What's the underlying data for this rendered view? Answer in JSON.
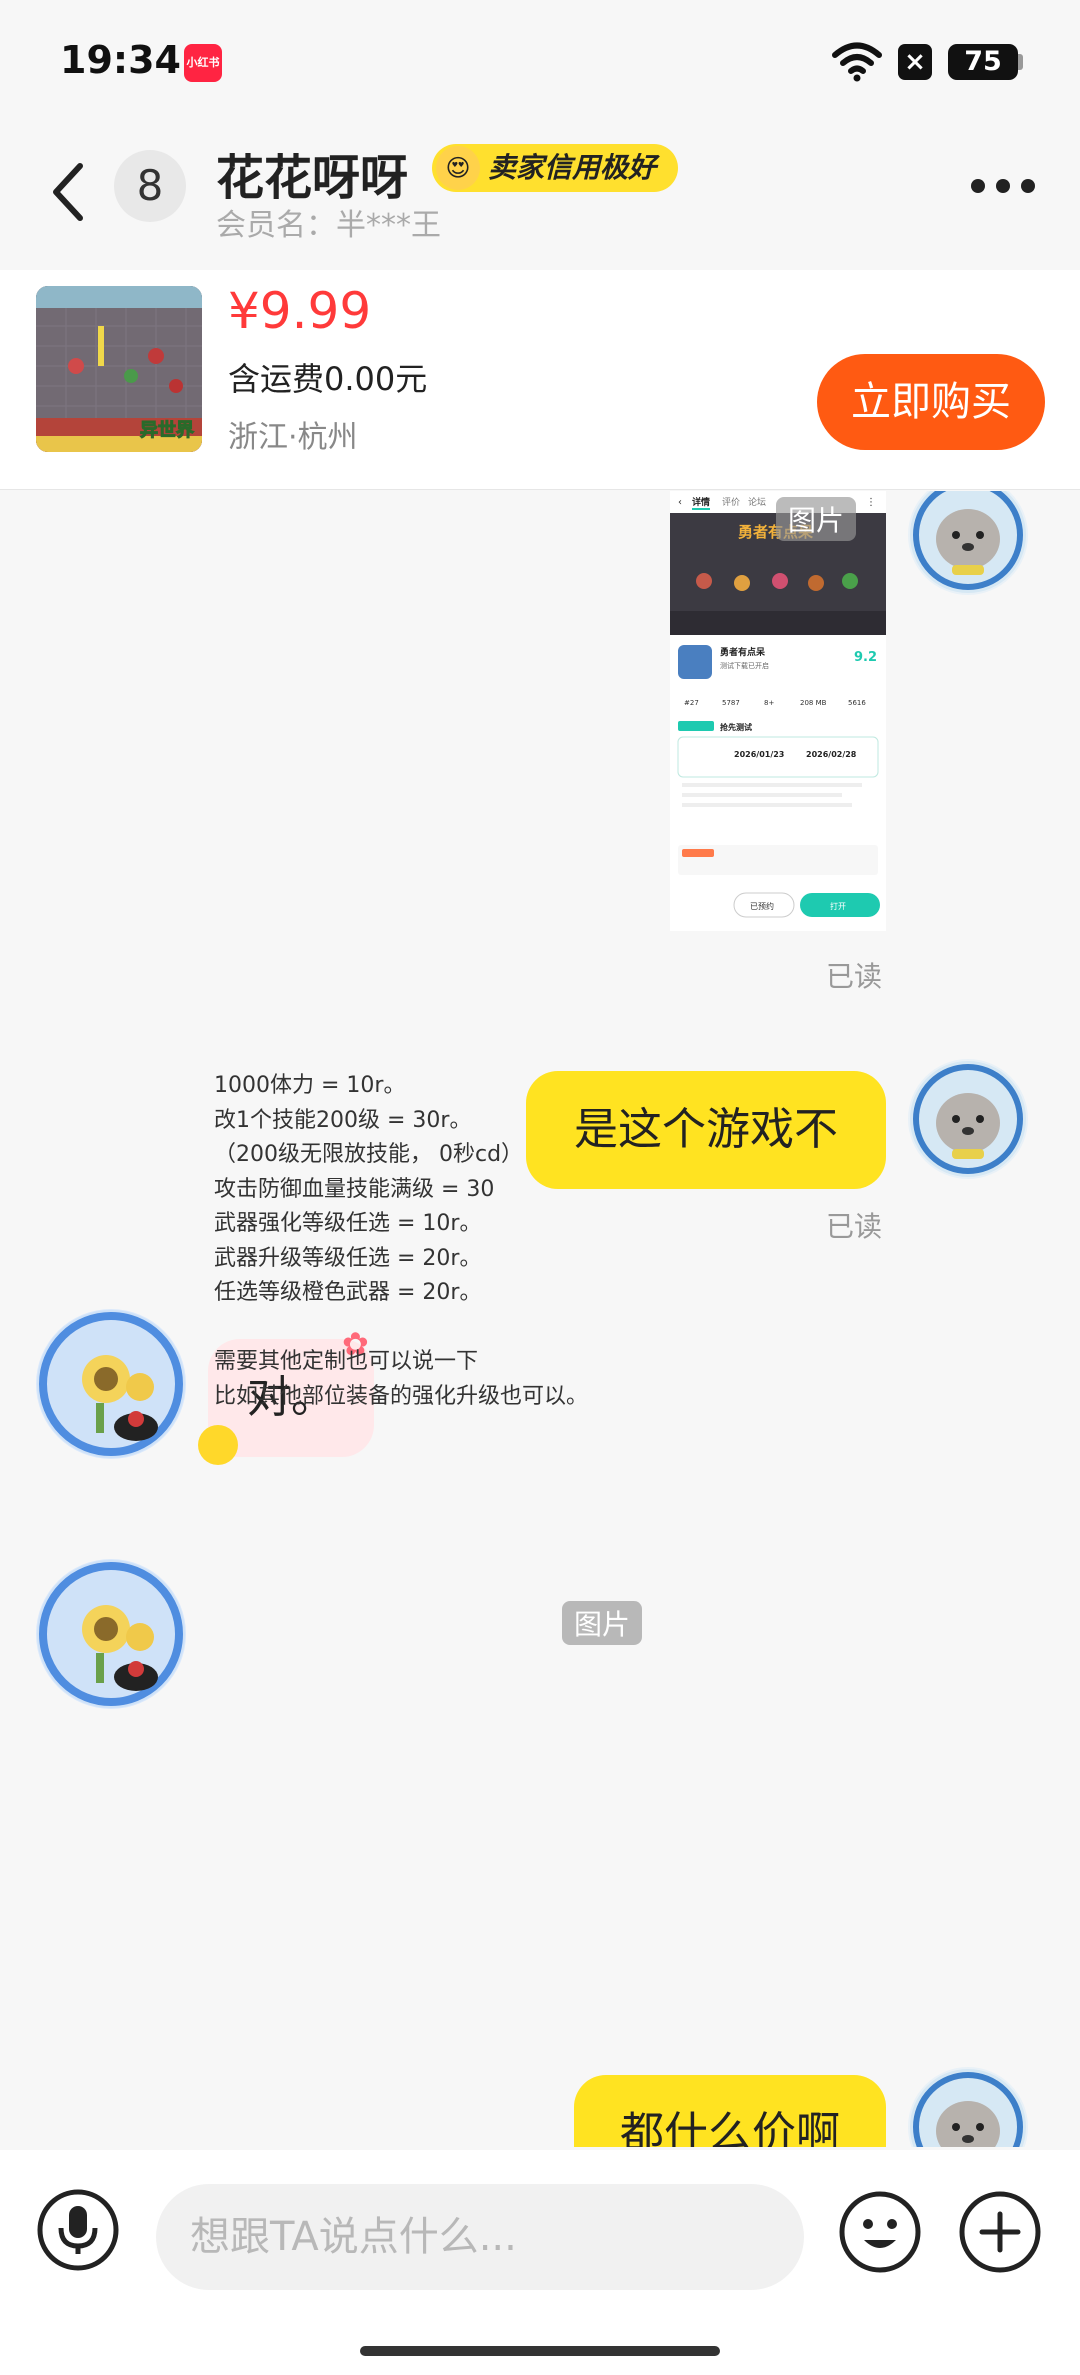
{
  "status_bar": {
    "time": "19:34",
    "app_badge": "小红书",
    "battery": "75"
  },
  "header": {
    "unread_count": "8",
    "seller_name": "花花呀呀",
    "credit_badge": "卖家信用极好",
    "member_name": "会员名：半***王"
  },
  "product": {
    "price": "¥9.99",
    "shipping": "含运费0.00元",
    "location": "浙江·杭州",
    "buy_label": "立即购买",
    "image_caption": "异世界"
  },
  "messages": [
    {
      "from": "me",
      "type": "image",
      "image_tag": "图片",
      "read_status": "已读",
      "screenshot": {
        "tabs": [
          "详情",
          "评价",
          "论坛"
        ],
        "game_banner": "勇者有点呆",
        "game_name": "勇者有点呆",
        "game_sub": "测试下载已开启",
        "rating": "9.2",
        "stats": [
          "#27",
          "5787",
          "8+",
          "208 MB",
          "5616"
        ],
        "test_title": "抢先测试",
        "test_start": "2026/01/23",
        "test_end": "2026/02/28",
        "reserved_label": "已预约",
        "open_label": "打开"
      }
    },
    {
      "from": "me",
      "type": "text",
      "text": "是这个游戏不",
      "read_status": "已读"
    },
    {
      "from": "seller",
      "type": "text",
      "text": "对。"
    },
    {
      "from": "seller",
      "type": "image",
      "image_tag": "图片",
      "text_lines": [
        "1000体力 = 10r。",
        "改1个技能200级 = 30r。",
        "（200级无限放技能， 0秒cd）",
        "攻击防御血量技能满级 = 30",
        "武器强化等级任选 = 10r。",
        "武器升级等级任选 = 20r。",
        "任选等级橙色武器 = 20r。",
        "",
        "需要其他定制也可以说一下",
        "比如其他部位装备的强化升级也可以。"
      ]
    },
    {
      "from": "me",
      "type": "text",
      "text": "都什么价啊"
    }
  ],
  "input": {
    "placeholder": "想跟TA说点什么..."
  },
  "colors": {
    "accent": "#ff5a12",
    "price": "#ff3a3a",
    "my_bubble": "#ffe321",
    "seller_bubble": "#ffe8ea",
    "badge": "#ffe02e"
  }
}
